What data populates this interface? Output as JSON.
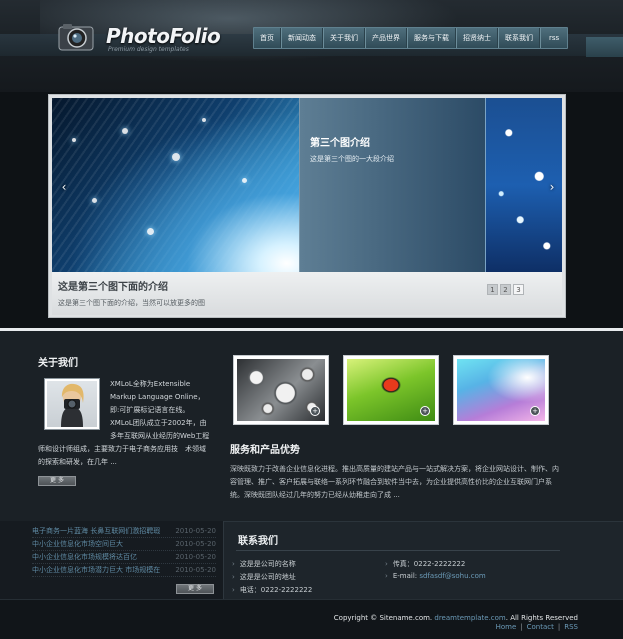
{
  "header": {
    "logo_title": "PhotoFolio",
    "logo_subtitle": "Premium design templates",
    "nav": [
      "首页",
      "新闻动态",
      "关于我们",
      "产品世界",
      "服务与下载",
      "招贤纳士",
      "联系我们",
      "rss"
    ]
  },
  "slider": {
    "caption_title": "第三个图介绍",
    "caption_text": "这是第三个图的一大段介绍",
    "info_title": "这是第三个图下面的介绍",
    "info_text": "这是第三个图下面的介绍，当然可以放更多的图",
    "pages": [
      "1",
      "2",
      "3"
    ],
    "active_page": 3,
    "prev_arrow": "‹",
    "next_arrow": "›"
  },
  "about": {
    "title": "关于我们",
    "text": "XMLoL全称为Extensible Markup Language Online，即:可扩展标记语言在线。XMLoL团队成立于2002年，由多年互联网从业经历的Web工程师和设计师组成，主要致力于电子商务应用技　术领域的探索和研发，在几年 ...",
    "more_label": "更 多"
  },
  "services": {
    "title": "服务和产品优势",
    "text": "深映既致力于改善企业信息化进程。推出高质量的建站产品与一站式解决方案，将企业网站设计、制作、内容管理、推广、客户拓展与联络一系列环节融合到软件当中去，为企业提供高性价比的企业互联网门户系统。深映既团队经过几年的努力已经从幼稚走向了成 ..."
  },
  "news": {
    "items": [
      {
        "title": "电子商务一片蓝海 长鼻互联网们激招聘瑕",
        "date": "2010-05-20"
      },
      {
        "title": "中小企业信息化市场空间巨大",
        "date": "2010-05-20"
      },
      {
        "title": "中小企业信息化市场规模将达百亿",
        "date": "2010-05-20"
      },
      {
        "title": "中小企业信息化市场潜力巨大 市场规模在",
        "date": "2010-05-20"
      }
    ],
    "more_label": "更 多"
  },
  "contact": {
    "title": "联系我们",
    "name": "这是是公司的名称",
    "address": "这是是公司的地址",
    "phone": "电话：0222-2222222",
    "fax": "传真：0222-2222222",
    "email_label": "E-mail: ",
    "email": "sdfasdf@sohu.com"
  },
  "footer": {
    "copyright_prefix": "Copyright © Sitename.com.",
    "copyright_link": "dreamtemplate.com",
    "copyright_suffix": ". All Rights Reserved",
    "links": [
      "Home",
      "Contact",
      "RSS"
    ]
  }
}
